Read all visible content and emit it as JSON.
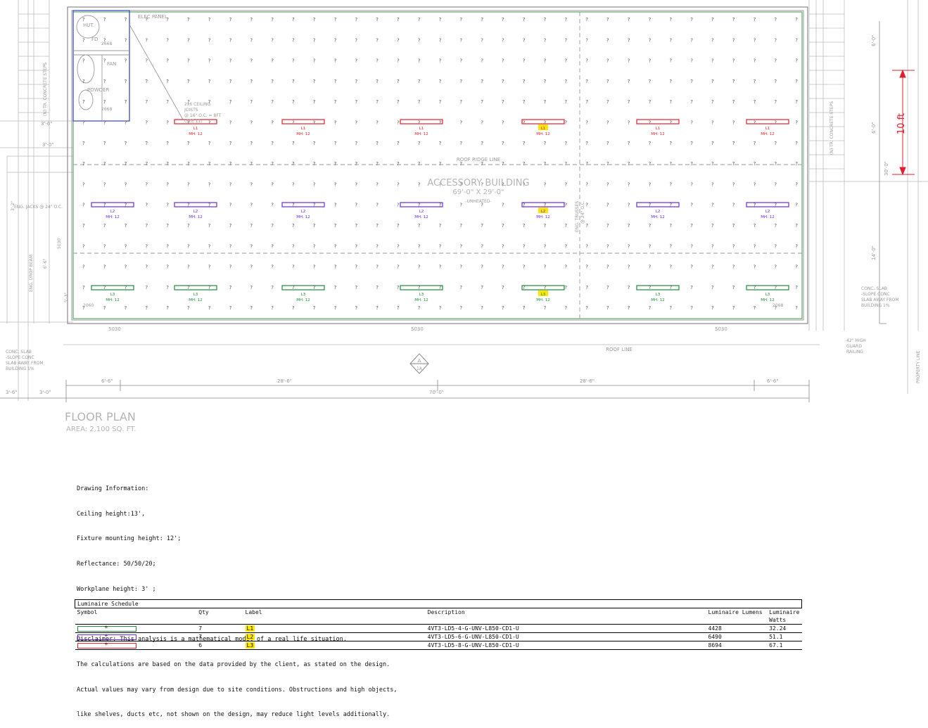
{
  "floor_plan": {
    "building_title": "ACCESSORY BUILDING",
    "building_size": "69'-0\" X 29'-0\"",
    "building_note": "-UNHEATED-",
    "plan_title": "FLOOR PLAN",
    "plan_area": "AREA: 2,100 SQ. FT.",
    "roof_ridge_label": "ROOF RIDGE LINE",
    "roof_line_label": "ROOF LINE",
    "elec_panel_label": "ELEC PANEL",
    "room_labels": [
      "HUT.",
      "FD",
      "FAN",
      "POWDER"
    ],
    "door_tags": [
      "2668",
      "2668",
      "2060",
      "2068"
    ],
    "window_tags": [
      "5030",
      "5030",
      "5030",
      "5030"
    ],
    "joists_note": [
      "2x6 CEILING",
      "JOISTS",
      "@ 16\" O.C. = 8FT",
      "(SEE 11)"
    ],
    "trusses_note": [
      "ENG. TRUSSES",
      "@ 24\" O.C."
    ],
    "jacks_note": "ENG. JACKS @ 24\" O.C.",
    "drop_beam_note": "ENG. DROP BEAM",
    "left_stairs_note": "(N) TR. CONCRETE STEPS",
    "right_stairs_note": "(N) TR. CONCRETE STEPS",
    "left_slab_note": [
      "CONC. SLAB",
      "-SLOPE CONC",
      "SLAB AWAY FROM",
      "BUILDING 1%"
    ],
    "right_slab_note": [
      "CONC. SLAB",
      "-SLOPE CONC",
      "SLAB AWAY FROM",
      "BUILDING 1%"
    ],
    "guard_note": [
      "42\" HIGH",
      "GUARD",
      "RAILING"
    ],
    "property_line_label": "PROPERTY LINE",
    "bottom_dims": [
      "6'-6\"",
      "28'-6\"",
      "28'-6\"",
      "6'-6\""
    ],
    "overall_dim": "70'-0\"",
    "left_dims": [
      "3'-6\"",
      "3'-0\"",
      "3'-0\"",
      "3'-6\""
    ],
    "left_vertical_dims": [
      "6'-6\"",
      "3'-2\"",
      "5'-3\""
    ],
    "right_vertical_dims": [
      "6'-0\"",
      "6'-0\"",
      "30'-0\"",
      "14'-0\""
    ],
    "section_marker": [
      "A",
      "1A"
    ],
    "scale_label": "10 ft",
    "fixture_readout": "MH: 12"
  },
  "fixture_rows": [
    {
      "label": "L1",
      "color": "#e0202a",
      "count": 6
    },
    {
      "label": "L2",
      "color": "#6a2ae0",
      "count": 7
    },
    {
      "label": "L3",
      "color": "#1e8a3c",
      "count": 7
    }
  ],
  "drawing_info": {
    "heading": "Drawing Information:",
    "lines": [
      "Ceiling height:13',",
      "Fixture mounting height: 12';",
      "Reflectance: 50/50/20;",
      "Workplane height: 3' ;"
    ]
  },
  "disclaimer": {
    "lines": [
      "Disclaimer: This analysis is a mathematical model of a real life situation.",
      "The calculations are based on the data provided by the client, as stated on the design.",
      "Actual values may vary from design due to site conditions. Obstructions and high objects,",
      "like shelves, ducts etc, not shown on the design, may reduce light levels additionally."
    ]
  },
  "schedule": {
    "title": "Luminaire Schedule",
    "headers": {
      "symbol": "Symbol",
      "qty": "Qty",
      "label": "Label",
      "description": "Description",
      "lumens": "Luminaire Lumens",
      "watts": "Luminaire Watts"
    },
    "rows": [
      {
        "color": "#1e8a3c",
        "qty": "7",
        "label": "L1",
        "description": "4VT3-LD5-4-G-UNV-L850-CD1-U",
        "lumens": "4428",
        "watts": "32.24"
      },
      {
        "color": "#6a2ae0",
        "qty": "7",
        "label": "L2",
        "description": "4VT3-LD5-6-G-UNV-L850-CD1-U",
        "lumens": "6490",
        "watts": "51.1"
      },
      {
        "color": "#e0202a",
        "qty": "6",
        "label": "L3",
        "description": "4VT3-LD5-8-G-UNV-L850-CD1-U",
        "lumens": "8694",
        "watts": "67.1"
      }
    ]
  }
}
